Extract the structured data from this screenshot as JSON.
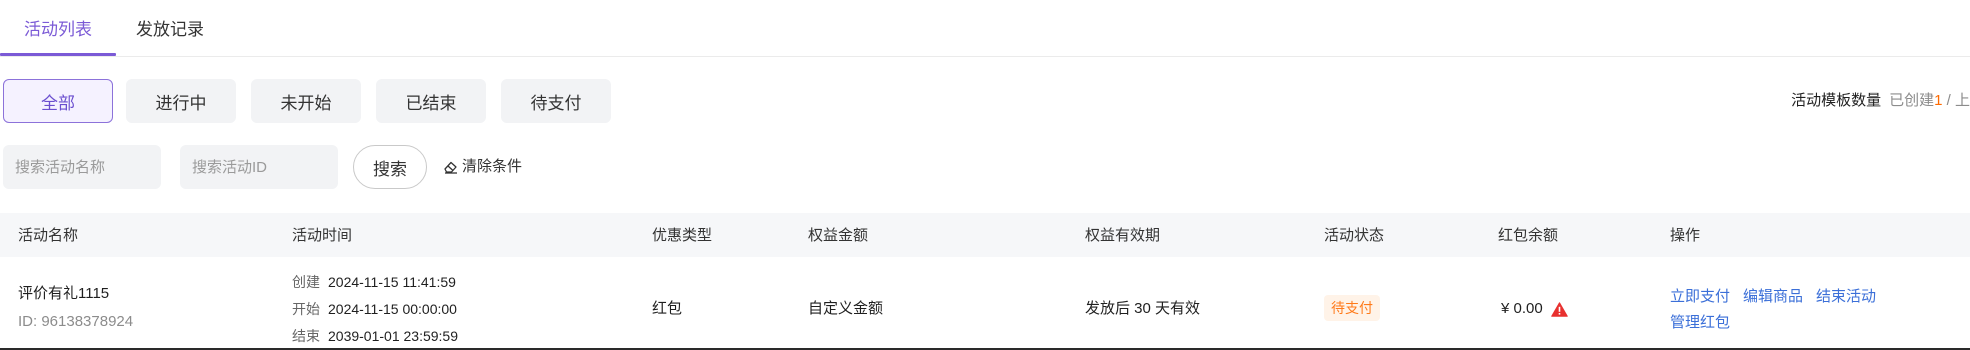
{
  "tabs": {
    "activity_list": "活动列表",
    "send_records": "发放记录"
  },
  "filters": [
    "全部",
    "进行中",
    "未开始",
    "已结束",
    "待支付"
  ],
  "template_count": {
    "label": "活动模板数量",
    "created_label": "已创建",
    "created_num": "1",
    "rest": " / 上"
  },
  "search": {
    "name_placeholder": "搜索活动名称",
    "id_placeholder": "搜索活动ID",
    "search_label": "搜索",
    "clear_label": "清除条件"
  },
  "table": {
    "columns": [
      "活动名称",
      "活动时间",
      "优惠类型",
      "权益金额",
      "权益有效期",
      "活动状态",
      "红包余额",
      "操作"
    ],
    "rows": [
      {
        "name": "评价有礼1115",
        "id": "ID: 96138378924",
        "create_label": "创建",
        "create_time": "2024-11-15 11:41:59",
        "start_label": "开始",
        "start_time": "2024-11-15 00:00:00",
        "end_label": "结束",
        "end_time": "2039-01-01 23:59:59",
        "type": "红包",
        "amount": "自定义金额",
        "validity": "发放后 30 天有效",
        "status": "待支付",
        "balance": "¥ 0.00",
        "actions": [
          "立即支付",
          "编辑商品",
          "结束活动",
          "管理红包"
        ]
      }
    ]
  },
  "colors": {
    "accent": "#7b5ad6",
    "link": "#3b6fd8",
    "status_pending": "#ff7a1a",
    "warning": "#e8312f"
  }
}
